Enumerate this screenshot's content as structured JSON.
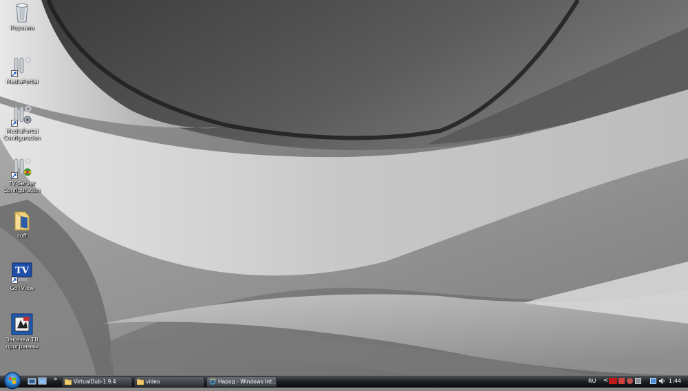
{
  "desktop": {
    "icons": [
      {
        "label": "Корзина",
        "icon": "recycle-bin-icon"
      },
      {
        "label": "MediaPortal",
        "icon": "mediaportal-icon"
      },
      {
        "label": "MediaPortal Configuration",
        "icon": "mediaportal-config-icon"
      },
      {
        "label": "TV-Server Configuration",
        "icon": "tv-server-config-icon"
      },
      {
        "label": "soft",
        "icon": "folder-icon"
      },
      {
        "label": "GoTView",
        "icon": "tv-icon"
      },
      {
        "label": "Закачка TB программы",
        "icon": "download-program-icon"
      }
    ]
  },
  "taskbar": {
    "quick_launch_more": "»",
    "tasks": [
      {
        "label": "VirtualDub-1.9.4",
        "icon": "folder-icon"
      },
      {
        "label": "video",
        "icon": "folder-icon"
      },
      {
        "label": "Народ - Windows Int...",
        "icon": "internet-explorer-icon"
      }
    ],
    "tray": {
      "language": "RU",
      "expand": "<",
      "clock": "1:44"
    }
  },
  "colors": {
    "taskbar_top": "#4a4f55",
    "taskbar_bottom": "#0a0b0c",
    "start_orb": "#3a8fd8"
  }
}
